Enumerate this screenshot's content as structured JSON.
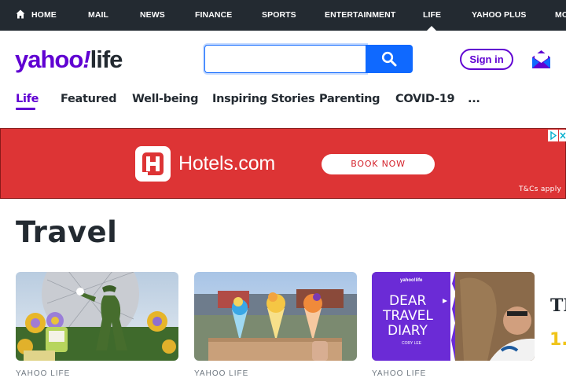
{
  "topnav": {
    "home": "HOME",
    "mail": "MAIL",
    "news": "NEWS",
    "finance": "FINANCE",
    "sports": "SPORTS",
    "entertainment": "ENTERTAINMENT",
    "life": "LIFE",
    "yahoo_plus": "YAHOO PLUS",
    "more": "MORE"
  },
  "logo": {
    "main": "yahoo",
    "bang": "!",
    "section": "life"
  },
  "search": {
    "value": "",
    "placeholder": ""
  },
  "account": {
    "signin_label": "Sign in"
  },
  "subnav": {
    "items": [
      "Life",
      "Featured",
      "Well-being",
      "Inspiring Stories",
      "Parenting",
      "COVID-19",
      "..."
    ]
  },
  "ad": {
    "brand": "Hotels.com",
    "cta": "BOOK NOW",
    "terms": "T&Cs apply"
  },
  "page": {
    "title": "Travel"
  },
  "cards": [
    {
      "source": "YAHOO LIFE",
      "image": "theme-park-topiary"
    },
    {
      "source": "YAHOO LIFE",
      "image": "frozen-desserts"
    },
    {
      "source": "YAHOO LIFE",
      "image": "dear-travel-diary",
      "overlay_brand": "yahoo!life",
      "overlay_title": [
        "DEAR",
        "TRAVEL",
        "DIARY"
      ],
      "overlay_author": "CORY LEE"
    }
  ],
  "sidebar": {
    "heading": "TR",
    "rank": "1."
  },
  "colors": {
    "brand": "#6001d2",
    "search": "#0f69ff",
    "ad_bg": "#dd3435",
    "topbar": "#232a31"
  }
}
